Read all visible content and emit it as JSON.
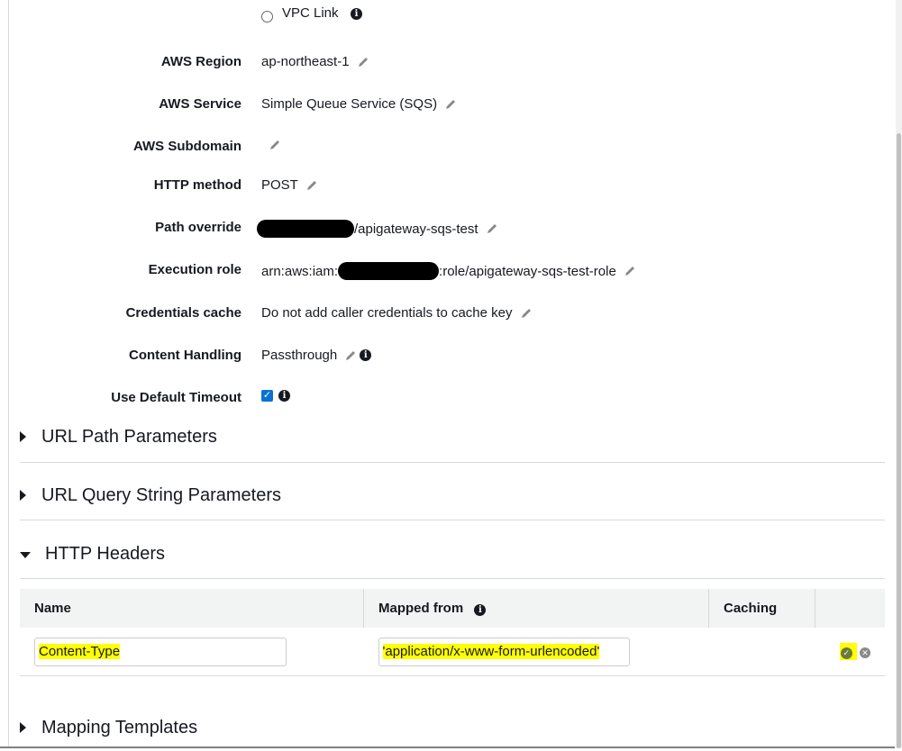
{
  "vpc_link": {
    "label": "VPC Link"
  },
  "fields": {
    "aws_region": {
      "label": "AWS Region",
      "value": "ap-northeast-1"
    },
    "aws_service": {
      "label": "AWS Service",
      "value": "Simple Queue Service (SQS)"
    },
    "aws_subdomain": {
      "label": "AWS Subdomain",
      "value": ""
    },
    "http_method": {
      "label": "HTTP method",
      "value": "POST"
    },
    "path_override": {
      "label": "Path override",
      "value": "/apigateway-sqs-test"
    },
    "execution_role": {
      "label": "Execution role",
      "value_prefix": "arn:aws:iam:",
      "value_suffix": ":role/apigateway-sqs-test-role"
    },
    "credentials_cache": {
      "label": "Credentials cache",
      "value": "Do not add caller credentials to cache key"
    },
    "content_handling": {
      "label": "Content Handling",
      "value": "Passthrough"
    },
    "default_timeout": {
      "label": "Use Default Timeout",
      "checked": true
    }
  },
  "sections": {
    "url_path": "URL Path Parameters",
    "url_query": "URL Query String Parameters",
    "http_headers": "HTTP Headers",
    "mapping_templates": "Mapping Templates"
  },
  "headers_table": {
    "columns": [
      "Name",
      "Mapped from",
      "Caching",
      ""
    ],
    "rows": [
      {
        "name": "Content-Type",
        "mapped_from": "'application/x-www-form-urlencoded'"
      }
    ]
  },
  "colors": {
    "highlight": "#ffff00",
    "checkbox": "#0972d3"
  }
}
